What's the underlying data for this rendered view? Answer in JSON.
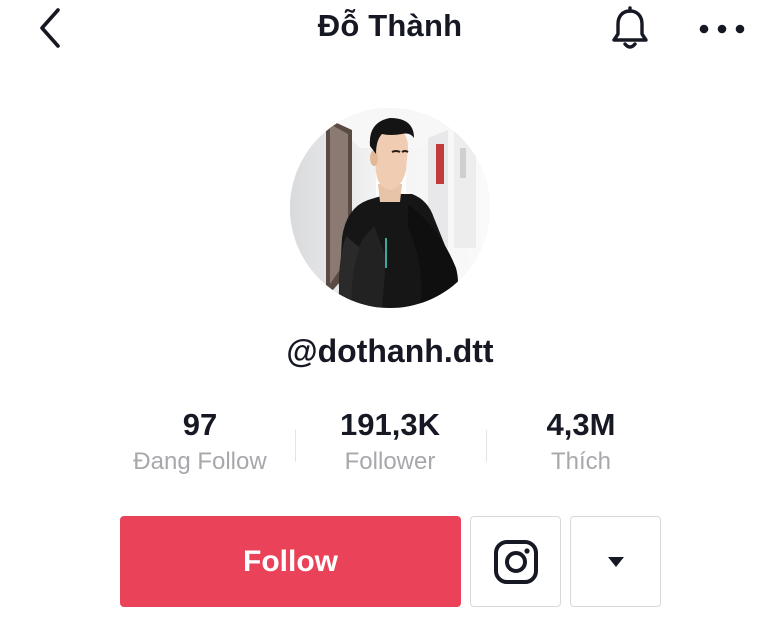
{
  "header": {
    "title": "Đỗ Thành",
    "back_icon": "chevron-left-icon",
    "notification_icon": "bell-icon",
    "more_icon": "more-horizontal-icon"
  },
  "profile": {
    "avatar": "profile-photo",
    "username": "@dothanh.dtt"
  },
  "stats": [
    {
      "value": "97",
      "label": "Đang Follow"
    },
    {
      "value": "191,3K",
      "label": "Follower"
    },
    {
      "value": "4,3M",
      "label": "Thích"
    }
  ],
  "actions": {
    "follow_label": "Follow",
    "instagram_icon": "instagram-icon",
    "dropdown_icon": "caret-down-icon"
  },
  "colors": {
    "accent": "#ea4359",
    "text_primary": "#161823",
    "text_secondary": "#a7a8ac",
    "border": "#d8d8da"
  }
}
